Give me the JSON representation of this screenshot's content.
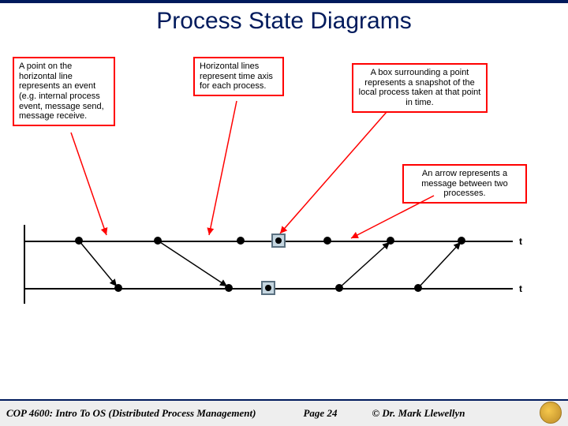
{
  "title": "Process State Diagrams",
  "callouts": {
    "point": "A point on the horizontal line represents an event (e.g. internal process event, message send, message receive.",
    "hline": "Horizontal lines represent time axis for each process.",
    "box": "A box surrounding a point represents a snapshot of the local process taken at that point in time.",
    "arrow": "An arrow represents a message between two processes."
  },
  "diagram": {
    "label_top": "t",
    "label_bot": "t"
  },
  "footer": {
    "course": "COP 4600: Intro To OS  (Distributed Process Management)",
    "page": "Page 24",
    "author": "© Dr. Mark Llewellyn"
  }
}
